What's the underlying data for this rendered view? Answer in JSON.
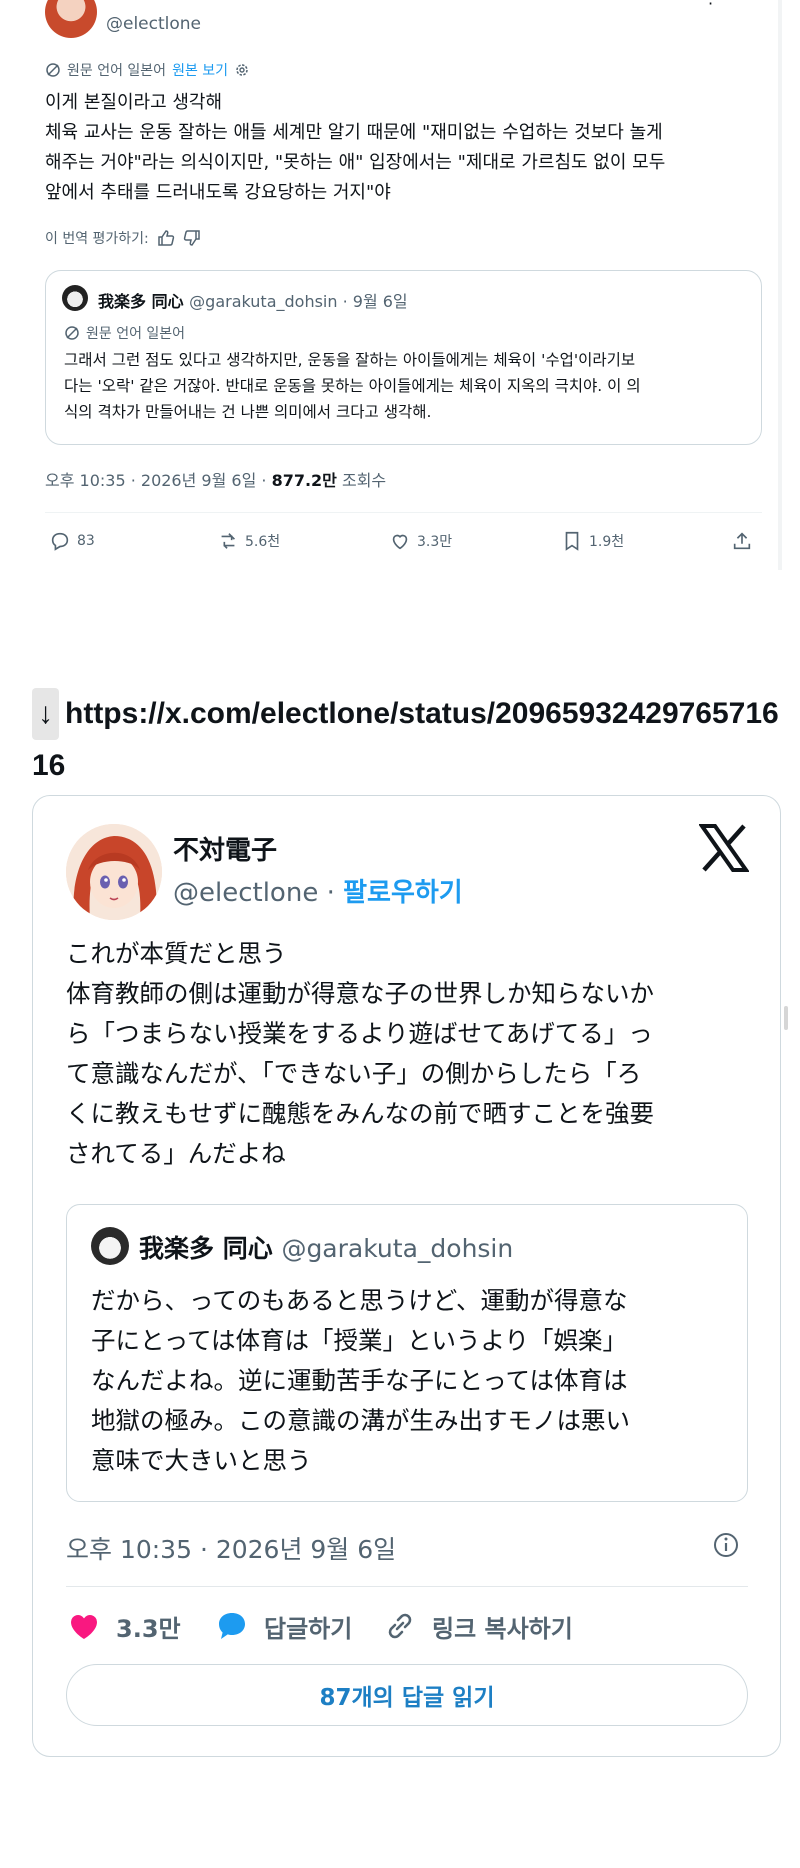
{
  "top_tweet": {
    "handle": "@electlone",
    "lang_note": "원문 언어 일본어",
    "view_original": "원본 보기",
    "body_lines": [
      "이게 본질이라고 생각해",
      "체육 교사는 운동 잘하는 애들 세계만 알기 때문에 \"재미없는 수업하는 것보다 놀게",
      "해주는 거야\"라는 의식이지만, \"못하는 애\" 입장에서는 \"제대로 가르침도 없이 모두",
      "앞에서 추태를 드러내도록 강요당하는 거지\"야"
    ],
    "rate_translation": "이 번역 평가하기:",
    "quote": {
      "name": "我楽多 同心",
      "handle_date": "@garakuta_dohsin · 9월 6일",
      "lang_note": "원문 언어 일본어",
      "body_lines": [
        "그래서 그런 점도 있다고 생각하지만, 운동을 잘하는 아이들에게는 체육이 '수업'이라기보",
        "다는 '오락' 같은 거잖아. 반대로 운동을 못하는 아이들에게는 체육이 지옥의 극치야. 이 의",
        "식의 격차가 만들어내는 건 나쁜 의미에서 크다고 생각해."
      ]
    },
    "meta_time": "오후 10:35 · 2026년 9월 6일 · ",
    "meta_views": "877.2만",
    "meta_views_label": " 조회수",
    "actions": {
      "replies": "83",
      "reposts": "5.6천",
      "likes": "3.3만",
      "bookmarks": "1.9천"
    }
  },
  "link_line": {
    "arrow": "↓",
    "url": "https://x.com/electlone/status/2096593242976571616"
  },
  "card": {
    "name": "不対電子",
    "handle": "@electlone",
    "separator": " · ",
    "follow": "팔로우하기",
    "body_lines": [
      "これが本質だと思う",
      "体育教師の側は運動が得意な子の世界しか知らないか",
      "ら「つまらない授業をするより遊ばせてあげてる」っ",
      "て意識なんだが、「できない子」の側からしたら「ろ",
      "くに教えもせずに醜態をみんなの前で晒すことを強要",
      "されてる」んだよね"
    ],
    "quote": {
      "name": "我楽多 同心",
      "handle": "@garakuta_dohsin",
      "body_lines": [
        "だから、ってのもあると思うけど、運動が得意な",
        "子にとっては体育は「授業」というより「娯楽」",
        "なんだよね。逆に運動苦手な子にとっては体育は",
        "地獄の極み。この意識の溝が生み出すモノは悪い",
        "意味で大きいと思う"
      ]
    },
    "time": "오후 10:35 · 2026년 9월 6일",
    "likes": "3.3만",
    "reply_label": "답글하기",
    "copy_link_label": "링크 복사하기",
    "read_replies": "87개의 답글 읽기",
    "colors": {
      "like": "#f91880",
      "reply": "#1d9bf0",
      "link": "#1d7fc4"
    }
  }
}
